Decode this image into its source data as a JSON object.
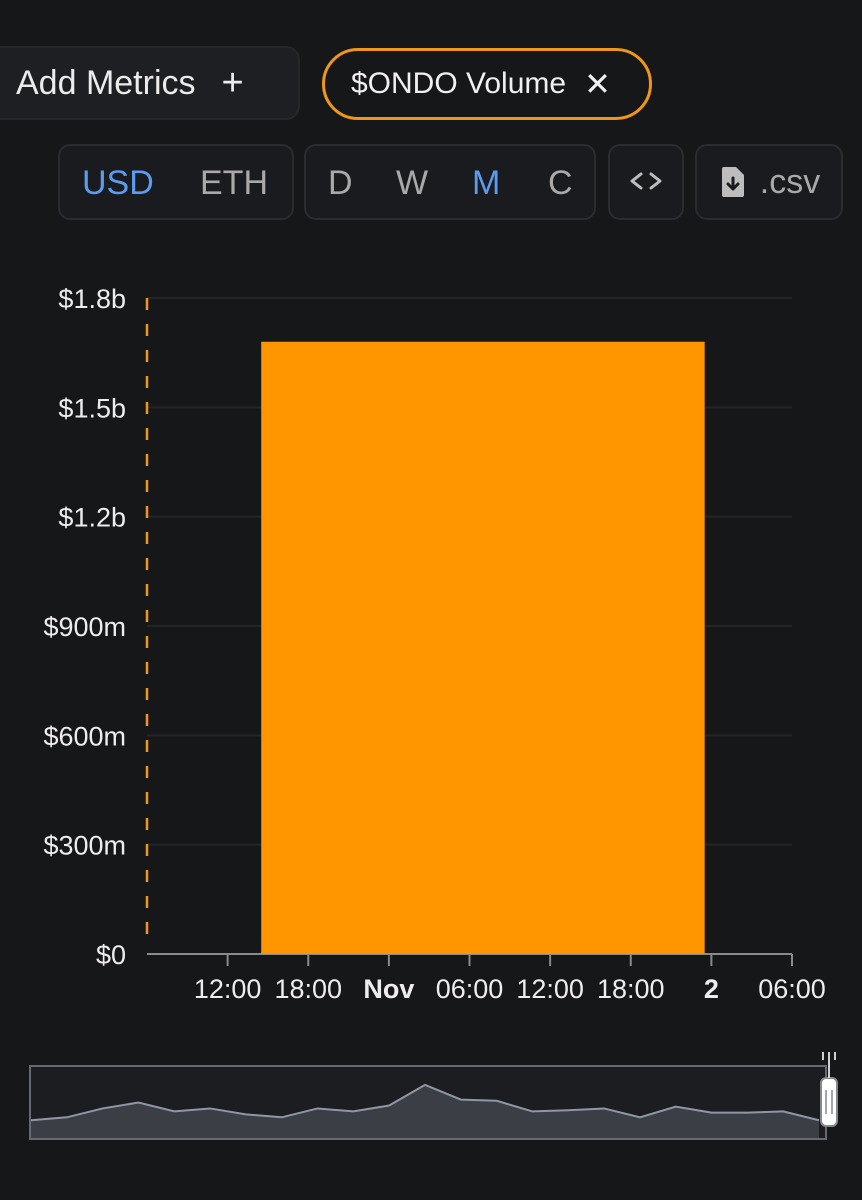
{
  "toolbar": {
    "add_metrics_label": "Add Metrics",
    "add_icon": "+",
    "metric_chip_label": "$ONDO Volume",
    "close_icon": "✕",
    "currency_options": [
      {
        "label": "USD",
        "active": true
      },
      {
        "label": "ETH",
        "active": false
      }
    ],
    "period_options": [
      {
        "label": "D",
        "active": false
      },
      {
        "label": "W",
        "active": false
      },
      {
        "label": "M",
        "active": true
      },
      {
        "label": "C",
        "active": false
      }
    ],
    "embed_icon": "code-brackets-icon",
    "csv_label": ".csv",
    "csv_icon": "file-download-icon"
  },
  "colors": {
    "accent": "#f0961a",
    "bar": "#ff9600",
    "active": "#5b9cf0",
    "background": "#161719"
  },
  "chart_data": {
    "type": "bar",
    "title": "",
    "xlabel": "",
    "ylabel": "",
    "x_tick_labels": [
      {
        "label": "12:00",
        "bold": false
      },
      {
        "label": "18:00",
        "bold": false
      },
      {
        "label": "Nov",
        "bold": true
      },
      {
        "label": "06:00",
        "bold": false
      },
      {
        "label": "12:00",
        "bold": false
      },
      {
        "label": "18:00",
        "bold": false
      },
      {
        "label": "2",
        "bold": true
      },
      {
        "label": "06:00",
        "bold": false
      }
    ],
    "y_tick_labels": [
      "$0",
      "$300m",
      "$600m",
      "$900m",
      "$1.2b",
      "$1.5b",
      "$1.8b"
    ],
    "y_tick_values": [
      0,
      300000000,
      600000000,
      900000000,
      1200000000,
      1500000000,
      1800000000
    ],
    "ylim": [
      0,
      1800000000
    ],
    "x_range_hours": [
      6,
      54
    ],
    "bars": [
      {
        "start_hour": 14.5,
        "end_hour": 47.5,
        "value": 1680000000
      }
    ],
    "grid": true,
    "navigator_series": [
      0.25,
      0.3,
      0.45,
      0.55,
      0.4,
      0.45,
      0.35,
      0.3,
      0.45,
      0.4,
      0.5,
      0.85,
      0.6,
      0.58,
      0.4,
      0.42,
      0.45,
      0.3,
      0.48,
      0.38,
      0.38,
      0.4,
      0.25
    ]
  }
}
